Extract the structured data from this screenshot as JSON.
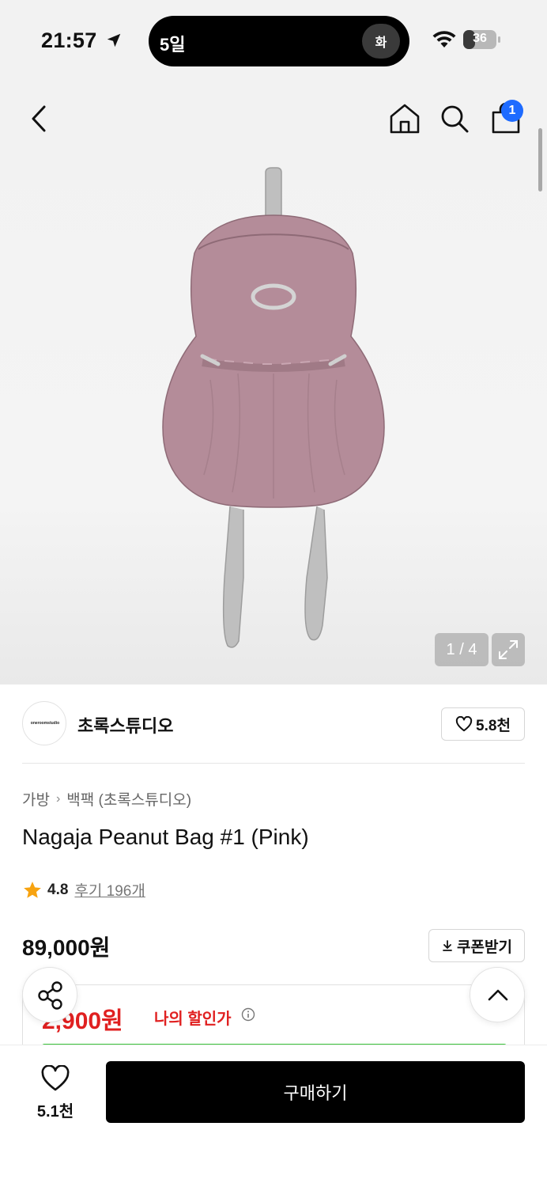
{
  "status_bar": {
    "time": "21:57",
    "island_text": "5일",
    "island_bubble": "화",
    "battery_level": 36,
    "battery_text": "36"
  },
  "nav": {
    "cart_count": "1",
    "icons": [
      "back-arrow-icon",
      "home-icon",
      "search-icon",
      "shopping-bag-icon"
    ]
  },
  "gallery": {
    "counter": "1 / 4",
    "expand_icon": "expand-icon"
  },
  "brand": {
    "logo_text": "oneroomstudio",
    "name": "초록스튜디오",
    "likes": "5.8천"
  },
  "product": {
    "breadcrumb": [
      "가방",
      "백팩 (초록스튜디오)"
    ],
    "title": "Nagaja Peanut Bag #1 (Pink)",
    "rating": "4.8",
    "reviews": "후기 196개",
    "price": "89,000원",
    "coupon_label": "쿠폰받기"
  },
  "discount": {
    "price": "2,900원",
    "label": "나의 할인가"
  },
  "bottom_bar": {
    "wish_count": "5.1천",
    "buy_label": "구매하기"
  },
  "colors": {
    "accent_blue": "#1e6bff",
    "discount_red": "#e02020",
    "progress_green": "#3ac33a",
    "bag_pink": "#b48c99"
  }
}
